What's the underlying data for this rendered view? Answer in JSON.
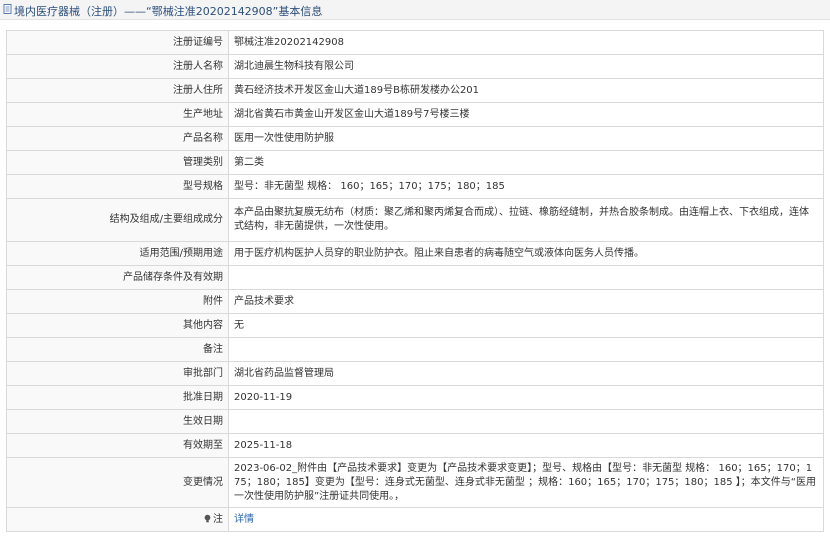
{
  "header": {
    "title": "境内医疗器械（注册）——“鄂械注准20202142908”基本信息"
  },
  "rows": [
    {
      "label": "注册证编号",
      "value": "鄂械注准20202142908"
    },
    {
      "label": "注册人名称",
      "value": "湖北迪晨生物科技有限公司"
    },
    {
      "label": "注册人住所",
      "value": "黄石经济技术开发区金山大道189号B栋研发楼办公201"
    },
    {
      "label": "生产地址",
      "value": "湖北省黄石市黄金山开发区金山大道189号7号楼三楼"
    },
    {
      "label": "产品名称",
      "value": "医用一次性使用防护服"
    },
    {
      "label": "管理类别",
      "value": "第二类"
    },
    {
      "label": "型号规格",
      "value": "型号：非无菌型 规格： 160；165；170；175；180；185"
    },
    {
      "label": "结构及组成/主要组成成分",
      "value": "本产品由聚抗复膜无纺布（材质：聚乙烯和聚丙烯复合而成）、拉链、橡筋经缝制，并热合胶条制成。由连帽上衣、下衣组成，连体式结构，非无菌提供，一次性使用。"
    },
    {
      "label": "适用范围/预期用途",
      "value": "用于医疗机构医护人员穿的职业防护衣。阻止来自患者的病毒随空气或液体向医务人员传播。"
    },
    {
      "label": "产品储存条件及有效期",
      "value": ""
    },
    {
      "label": "附件",
      "value": "产品技术要求"
    },
    {
      "label": "其他内容",
      "value": "无"
    },
    {
      "label": "备注",
      "value": ""
    },
    {
      "label": "审批部门",
      "value": "湖北省药品监督管理局"
    },
    {
      "label": "批准日期",
      "value": "2020-11-19"
    },
    {
      "label": "生效日期",
      "value": ""
    },
    {
      "label": "有效期至",
      "value": "2025-11-18"
    },
    {
      "label": "变更情况",
      "value": "2023-06-02_附件由【产品技术要求】变更为【产品技术要求变更】；型号、规格由【型号：非无菌型 规格： 160；165；170；175；180；185】变更为【型号：连身式无菌型、连身式非无菌型 ；规格：160；165；170；175；180；185 】；本文件与“医用一次性使用防护服”注册证共同使用。，"
    }
  ],
  "note": {
    "label": "注",
    "link_text": "详情",
    "link_color": "#2b66b5"
  }
}
